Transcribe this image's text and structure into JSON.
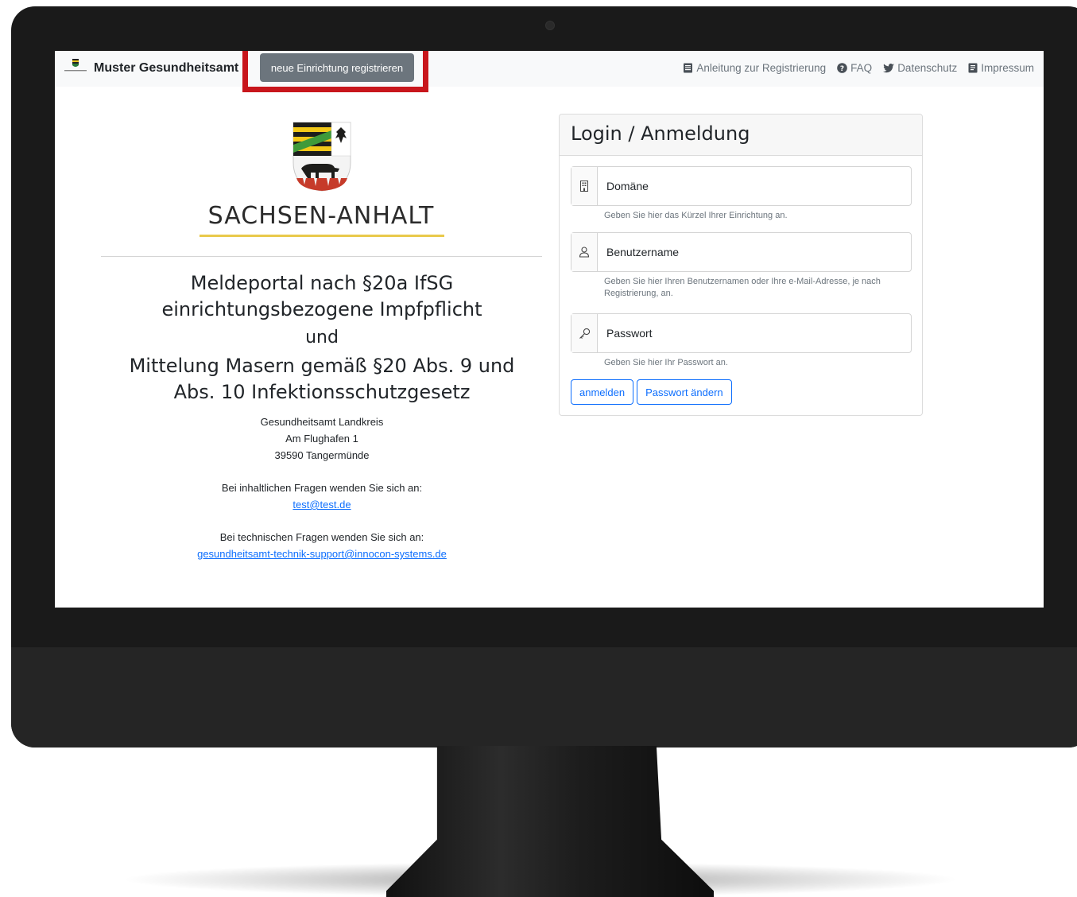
{
  "navbar": {
    "brand_name": "Muster Gesundheitsamt",
    "register_button": "neue Einrichtung registrieren",
    "links": [
      {
        "label": "Anleitung zur Registrierung",
        "icon": "book-icon"
      },
      {
        "label": "FAQ",
        "icon": "question-circle-icon"
      },
      {
        "label": "Datenschutz",
        "icon": "twitter-icon"
      },
      {
        "label": "Impressum",
        "icon": "document-icon"
      }
    ]
  },
  "branding": {
    "state_name": "SACHSEN-ANHALT",
    "accent_color": "#e9c94a"
  },
  "info": {
    "heading_line1": "Meldeportal nach §20a IfSG",
    "heading_line2": "einrichtungsbezogene Impfpflicht",
    "conjunction": "und",
    "heading2_line1": "Mittelung Masern gemäß §20 Abs. 9 und",
    "heading2_line2": "Abs. 10 Infektionsschutzgesetz",
    "address": [
      "Gesundheitsamt Landkreis",
      "Am Flughafen 1",
      "39590 Tangermünde"
    ],
    "content_question": "Bei inhaltlichen Fragen wenden Sie sich an:",
    "content_email": "test@test.de",
    "tech_question": "Bei technischen Fragen wenden Sie sich an:",
    "tech_email": "gesundheitsamt-technik-support@innocon-systems.de"
  },
  "login": {
    "title": "Login / Anmeldung",
    "domain_placeholder": "Domäne",
    "domain_help": "Geben Sie hier das Kürzel Ihrer Einrichtung an.",
    "user_placeholder": "Benutzername",
    "user_help": "Geben Sie hier Ihren Benutzernamen oder Ihre e-Mail-Adresse, je nach Registrierung, an.",
    "password_placeholder": "Passwort",
    "password_help": "Geben Sie hier Ihr Passwort an.",
    "login_button": "anmelden",
    "change_password_button": "Passwort ändern"
  },
  "colors": {
    "highlight": "#c8161c",
    "primary": "#0d6efd",
    "secondary": "#6c757d"
  }
}
